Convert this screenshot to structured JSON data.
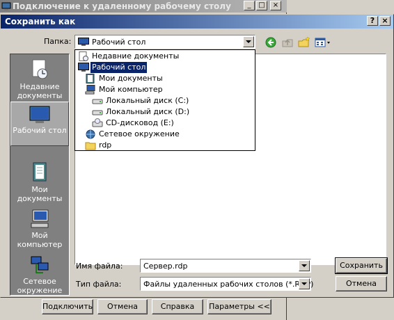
{
  "background_window": {
    "title": "Подключение к удаленному рабочему столу",
    "buttons": {
      "connect": "Подключить",
      "cancel": "Отмена",
      "help": "Справка",
      "options": "Параметры <<"
    }
  },
  "dialog": {
    "title": "Сохранить как",
    "look_in_label": "Папка:",
    "look_in_value": "Рабочий стол",
    "places": [
      {
        "label": "Недавние документы",
        "icon": "recent-documents-icon"
      },
      {
        "label": "Рабочий стол",
        "icon": "desktop-icon"
      },
      {
        "label": "Мои документы",
        "icon": "my-documents-icon"
      },
      {
        "label": "Мой компьютер",
        "icon": "my-computer-icon"
      },
      {
        "label": "Сетевое окружение",
        "icon": "network-icon"
      }
    ],
    "dropdown_items": [
      {
        "label": "Недавние документы",
        "icon": "recent-documents-icon"
      },
      {
        "label": "Рабочий стол",
        "icon": "desktop-icon"
      },
      {
        "label": "Мои документы",
        "icon": "my-documents-icon"
      },
      {
        "label": "Мой компьютер",
        "icon": "my-computer-icon"
      },
      {
        "label": "Локальный диск (C:)",
        "icon": "drive-icon"
      },
      {
        "label": "Локальный диск (D:)",
        "icon": "drive-icon"
      },
      {
        "label": "CD-дисковод (E:)",
        "icon": "cd-drive-icon"
      },
      {
        "label": "Сетевое окружение",
        "icon": "network-icon"
      },
      {
        "label": "rdp",
        "icon": "folder-icon"
      }
    ],
    "filename_label": "Имя файла:",
    "filename_value": "Сервер.rdp",
    "filetype_label": "Тип файла:",
    "filetype_value": "Файлы удаленных рабочих столов (*.RDP)",
    "save_button": "Сохранить",
    "cancel_button": "Отмена"
  }
}
